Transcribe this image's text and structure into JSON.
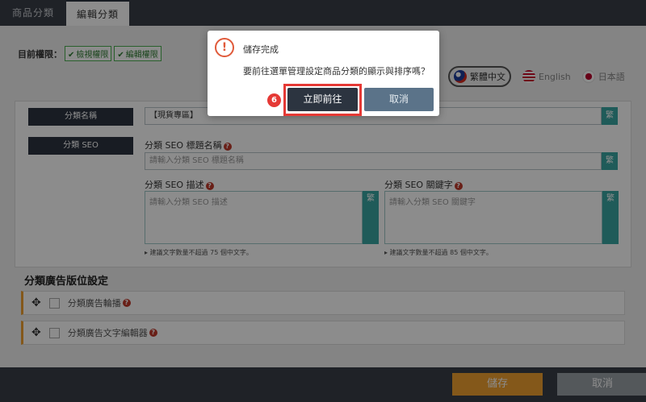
{
  "tabs": [
    {
      "label": "商品分類",
      "active": false
    },
    {
      "label": "編輯分類",
      "active": true
    }
  ],
  "permissions": {
    "label": "目前權限：",
    "tags": [
      "檢視權限",
      "編輯權限"
    ]
  },
  "languages": [
    {
      "label": "繁體中文",
      "active": true
    },
    {
      "label": "English",
      "active": false
    },
    {
      "label": "日本語",
      "active": false
    }
  ],
  "form": {
    "name_label": "分類名稱",
    "name_value": "【現貨專區】",
    "fan": "繁",
    "seo_label": "分類 SEO",
    "seo_title_heading": "分類 SEO 標題名稱",
    "seo_title_placeholder": "請輸入分類 SEO 標題名稱",
    "seo_desc_heading": "分類 SEO 描述",
    "seo_desc_placeholder": "請輸入分類 SEO 描述",
    "seo_desc_hint": "▸ 建議文字數量不超過 75 個中文字。",
    "seo_kw_heading": "分類 SEO 關鍵字",
    "seo_kw_placeholder": "請輸入分類 SEO 關鍵字",
    "seo_kw_hint": "▸ 建議文字數量不超過 85 個中文字。"
  },
  "ads": {
    "title": "分類廣告版位設定",
    "items": [
      "分類廣告輪播",
      "分類廣告文字編輯器"
    ]
  },
  "footer": {
    "save": "儲存",
    "cancel": "取消"
  },
  "modal": {
    "title": "儲存完成",
    "message": "要前往選單管理設定商品分類的顯示與排序嗎？",
    "confirm": "立即前往",
    "cancel": "取消",
    "step": "6"
  },
  "colors": {
    "dark": "#2c3440",
    "accent": "#f0a030",
    "teal": "#3aa7a3",
    "highlight": "#e53935"
  }
}
